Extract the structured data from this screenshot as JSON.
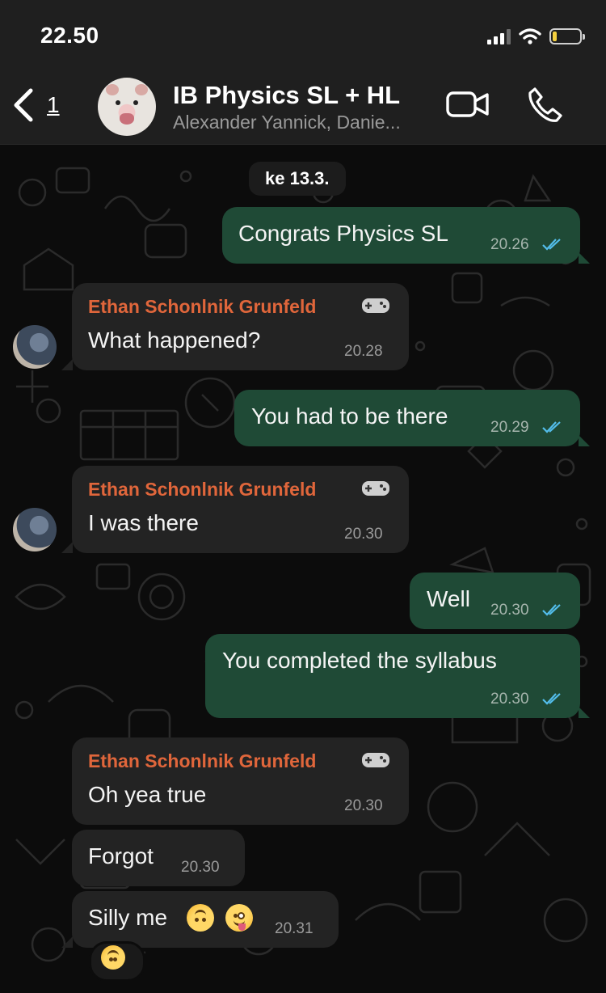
{
  "status_bar": {
    "time": "22.50"
  },
  "header": {
    "back_count": "1",
    "title": "IB Physics SL + HL",
    "subtitle": "Alexander Yannick, Danie..."
  },
  "date_separator": "ke 13.3.",
  "messages": [
    {
      "direction": "out",
      "text": "Congrats Physics SL",
      "time": "20.26",
      "read": true
    },
    {
      "direction": "in",
      "sender": "Ethan Schonlnik Grunfeld",
      "text": "What happened?",
      "time": "20.28"
    },
    {
      "direction": "out",
      "text": "You had to be there",
      "time": "20.29",
      "read": true
    },
    {
      "direction": "in",
      "sender": "Ethan Schonlnik Grunfeld",
      "text": "I was there",
      "time": "20.30"
    },
    {
      "direction": "out",
      "text": "Well",
      "time": "20.30",
      "read": true
    },
    {
      "direction": "out",
      "text": "You completed the syllabus",
      "time": "20.30",
      "read": true
    },
    {
      "direction": "in",
      "sender": "Ethan Schonlnik Grunfeld",
      "text": "Oh yea true",
      "time": "20.30"
    },
    {
      "direction": "in",
      "text": "Forgot",
      "time": "20.30"
    },
    {
      "direction": "in",
      "text": "Silly me",
      "time": "20.31",
      "emojis": [
        "upside-down-face",
        "zany-face"
      ]
    }
  ],
  "reaction": "upside-down-face",
  "colors": {
    "outgoing_bubble": "#1f4a36",
    "incoming_bubble": "#232323",
    "sender_name": "#e0663b",
    "read_ticks": "#53bdeb"
  },
  "icons": [
    "back-chevron-icon",
    "video-call-icon",
    "phone-icon",
    "gamepad-icon",
    "double-check-icon"
  ]
}
